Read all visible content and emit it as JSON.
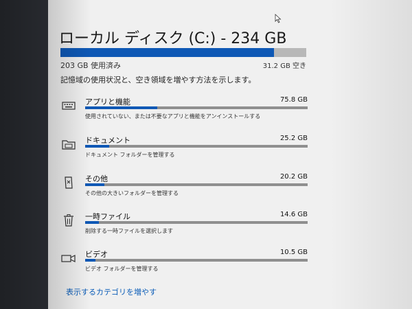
{
  "window": {
    "title": "ローカル ディスク (C:) - 234 GB"
  },
  "usage": {
    "used_label": "203 GB 使用済み",
    "free_label": "31.2 GB 空き",
    "used_fraction": 0.868,
    "description": "記憶域の使用状況と、空き領域を増やす方法を示します。",
    "bar_color": "#0e58b5",
    "track_color": "#b8b8b8"
  },
  "categories": [
    {
      "name": "アプリと機能",
      "size": "75.8 GB",
      "description": "使用されていない、または不要なアプリと機能をアンインストールする",
      "fill_fraction": 0.324,
      "icon": "keyboard-icon"
    },
    {
      "name": "ドキュメント",
      "size": "25.2 GB",
      "description": "ドキュメント フォルダーを管理する",
      "fill_fraction": 0.108,
      "icon": "folder-icon"
    },
    {
      "name": "その他",
      "size": "20.2 GB",
      "description": "その他の大きいフォルダーを管理する",
      "fill_fraction": 0.086,
      "icon": "other-file-icon"
    },
    {
      "name": "一時ファイル",
      "size": "14.6 GB",
      "description": "削除する一時ファイルを選択します",
      "fill_fraction": 0.062,
      "icon": "trash-icon"
    },
    {
      "name": "ビデオ",
      "size": "10.5 GB",
      "description": "ビデオ フォルダーを管理する",
      "fill_fraction": 0.045,
      "icon": "video-camera-icon"
    }
  ],
  "footer": {
    "more_link": "表示するカテゴリを増やす"
  }
}
